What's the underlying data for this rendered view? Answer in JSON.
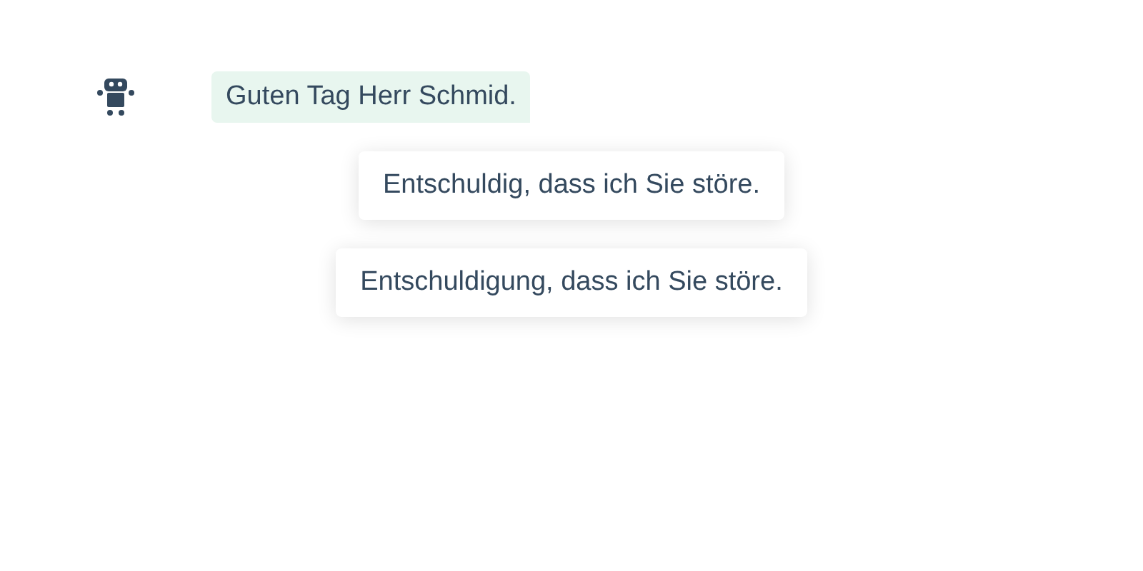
{
  "message": {
    "text": "Guten Tag Herr Schmid."
  },
  "options": [
    {
      "label": "Entschuldig, dass ich Sie störe."
    },
    {
      "label": "Entschuldigung, dass ich Sie störe."
    }
  ]
}
